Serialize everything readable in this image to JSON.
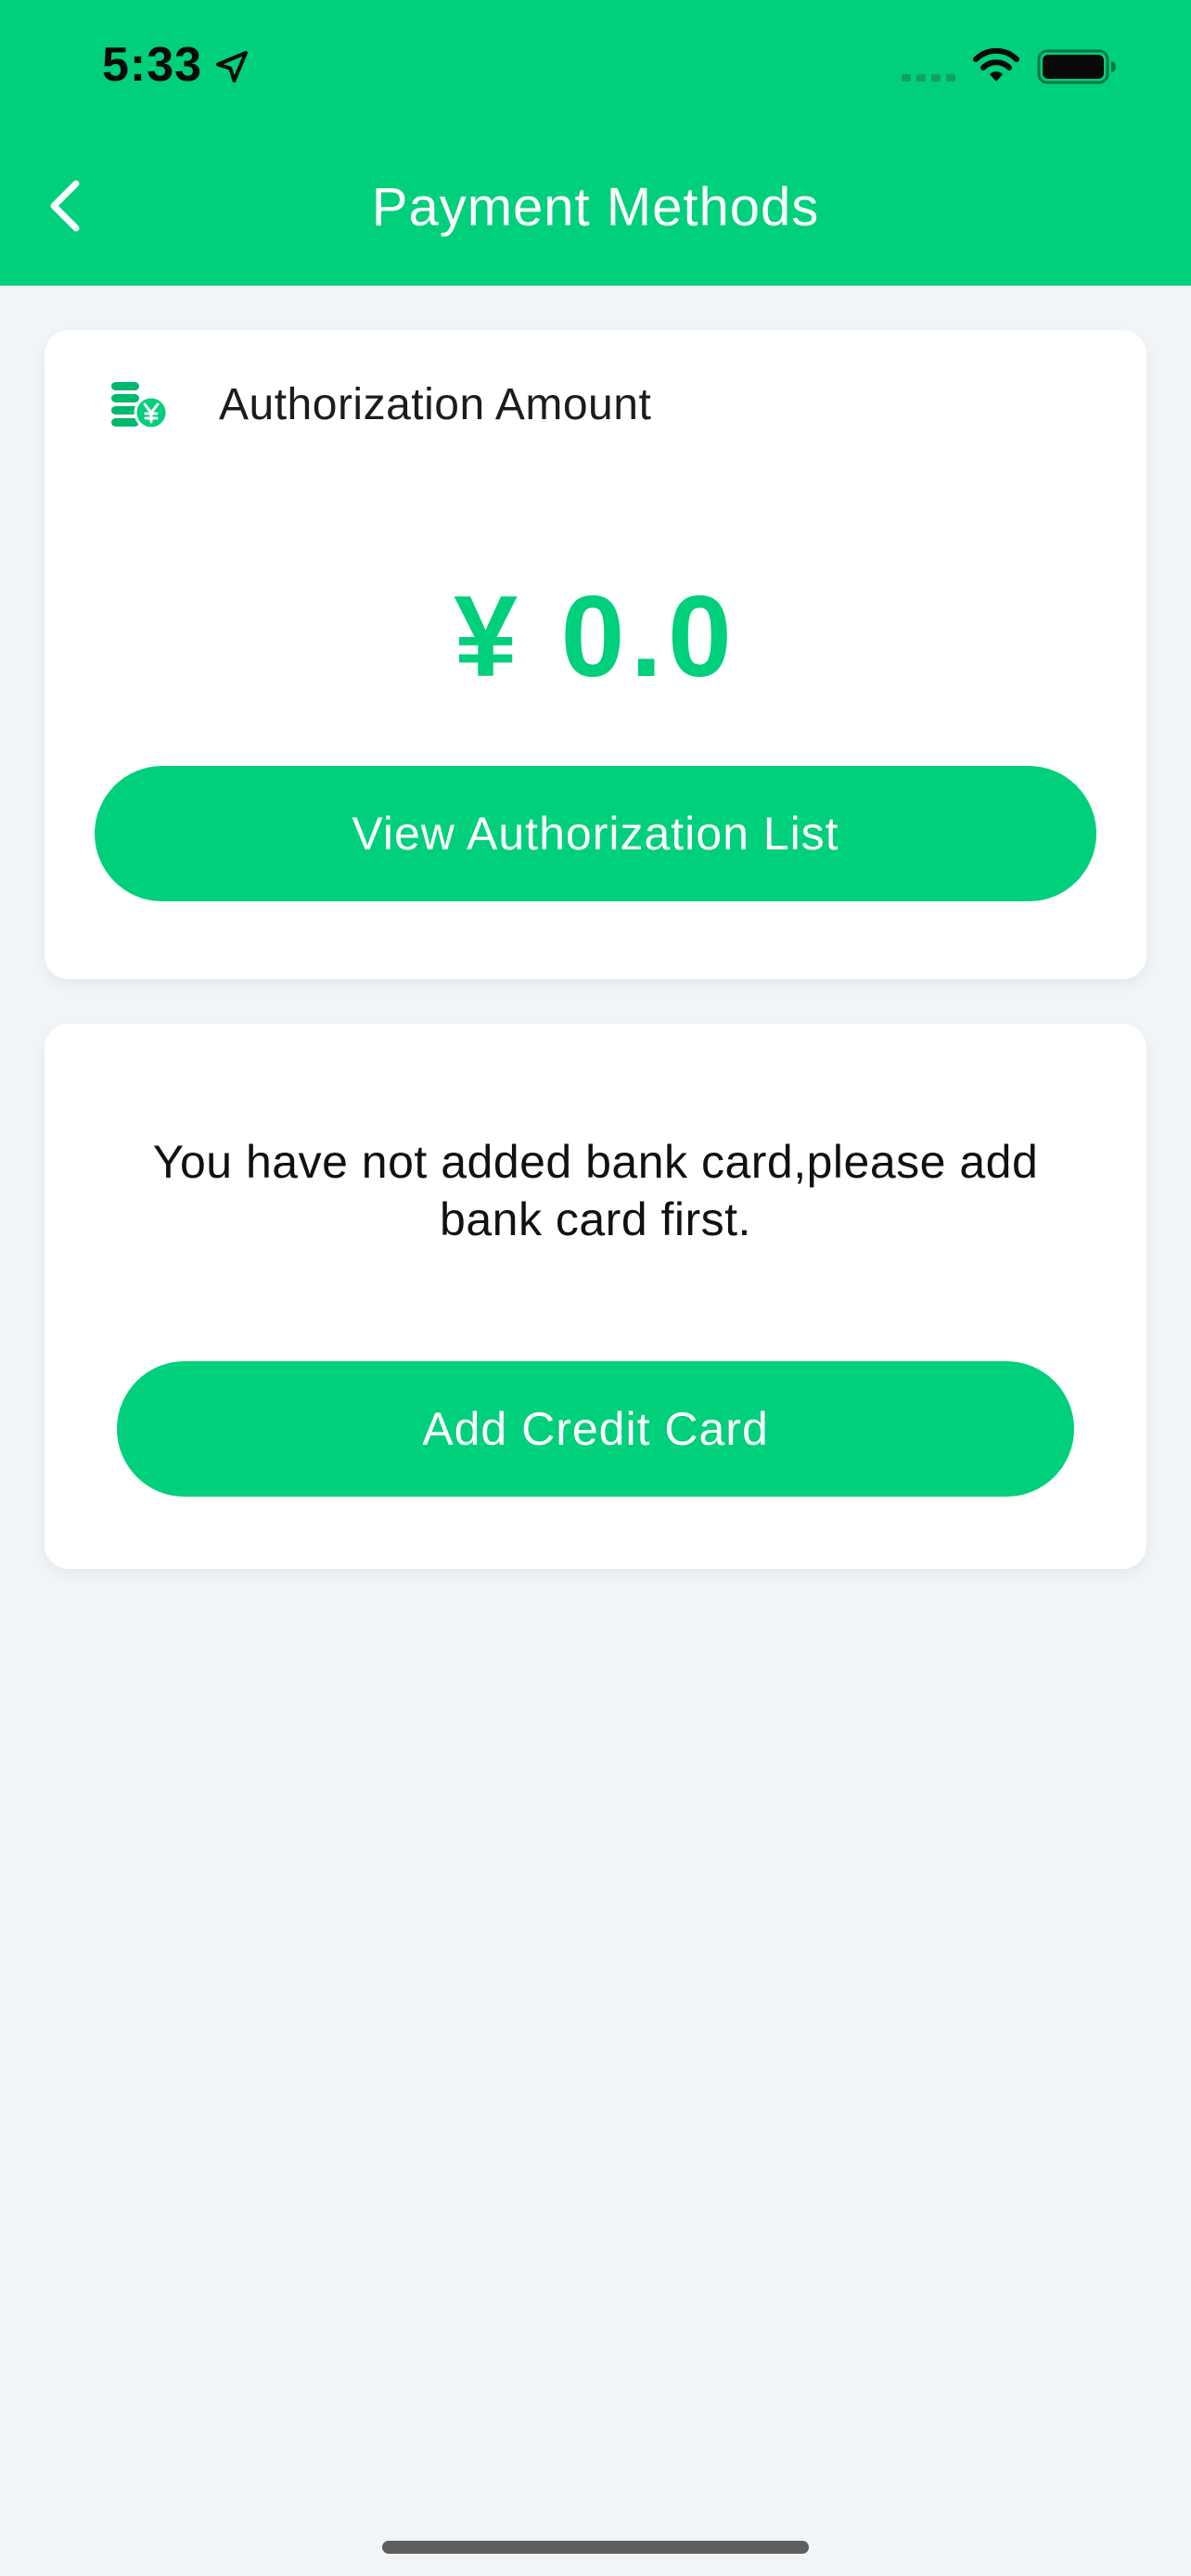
{
  "status_bar": {
    "time": "5:33"
  },
  "nav": {
    "title": "Payment Methods"
  },
  "authorization": {
    "label": "Authorization Amount",
    "amount": "¥ 0.0",
    "button_label": "View Authorization List"
  },
  "bank": {
    "empty_message": "You have not added bank card,please add bank card first.",
    "button_label": "Add Credit Card"
  },
  "colors": {
    "brand": "#00cf7b",
    "background": "#f2f5f8"
  },
  "icons": {
    "back": "chevron-left-icon",
    "coins": "coins-yen-icon",
    "location": "location-arrow-icon",
    "signal": "signal-icon",
    "wifi": "wifi-icon",
    "battery": "battery-icon"
  }
}
